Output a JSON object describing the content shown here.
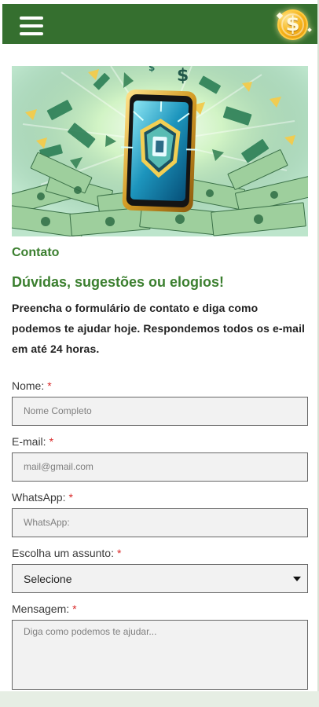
{
  "header": {
    "menu_icon": "hamburger-menu-icon",
    "coin_icon": "dollar-coin-icon",
    "coin_symbol": "$",
    "bar_color": "#356f2f",
    "coin_color": "#f6b51c"
  },
  "hero": {
    "image_icon": "phone-money-illustration"
  },
  "page": {
    "title": "Contato",
    "subtitle": "Dúvidas, sugestões ou elogios!",
    "intro": "Preencha o formulário de contato e diga como podemos te ajudar hoje.  Respondemos todos os e-mail em até 24 horas.",
    "accent_color": "#3b7f2f"
  },
  "form": {
    "required_mark": "*",
    "name": {
      "label": "Nome:",
      "placeholder": "Nome Completo",
      "value": ""
    },
    "email": {
      "label": "E-mail:",
      "placeholder": "mail@gmail.com",
      "value": ""
    },
    "whatsapp": {
      "label": "WhatsApp:",
      "placeholder": "WhatsApp:",
      "value": ""
    },
    "subject": {
      "label": "Escolha um assunto:",
      "selected": "Selecione",
      "caret_icon": "caret-down-icon"
    },
    "message": {
      "label": "Mensagem:",
      "placeholder": "Diga como podemos te ajudar...",
      "value": ""
    }
  }
}
